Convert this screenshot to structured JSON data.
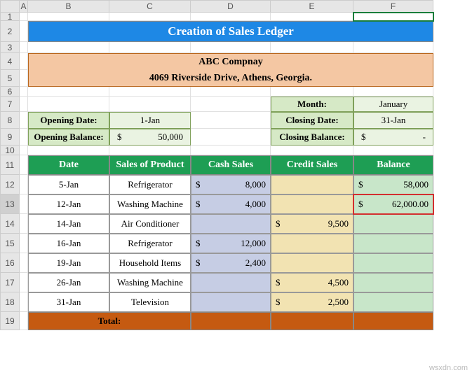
{
  "columns": [
    "A",
    "B",
    "C",
    "D",
    "E",
    "F"
  ],
  "rows": [
    "1",
    "2",
    "3",
    "4",
    "5",
    "6",
    "7",
    "8",
    "9",
    "10",
    "11",
    "12",
    "13",
    "14",
    "15",
    "16",
    "17",
    "18",
    "19"
  ],
  "title": "Creation of Sales Ledger",
  "company": {
    "name": "ABC Compnay",
    "address": "4069 Riverside Drive, Athens, Georgia."
  },
  "opening": {
    "date_label": "Opening Date:",
    "date_value": "1-Jan",
    "balance_label": "Opening Balance:",
    "balance_value": "50,000"
  },
  "closing": {
    "month_label": "Month:",
    "month_value": "January",
    "date_label": "Closing Date:",
    "date_value": "31-Jan",
    "balance_label": "Closing Balance:",
    "balance_value": "-"
  },
  "headers": {
    "date": "Date",
    "product": "Sales of Product",
    "cash": "Cash Sales",
    "credit": "Credit Sales",
    "balance": "Balance"
  },
  "rows_data": [
    {
      "date": "5-Jan",
      "product": "Refrigerator",
      "cash": "8,000",
      "credit": "",
      "balance": "58,000"
    },
    {
      "date": "12-Jan",
      "product": "Washing Machine",
      "cash": "4,000",
      "credit": "",
      "balance": "62,000.00"
    },
    {
      "date": "14-Jan",
      "product": "Air Conditioner",
      "cash": "",
      "credit": "9,500",
      "balance": ""
    },
    {
      "date": "16-Jan",
      "product": "Refrigerator",
      "cash": "12,000",
      "credit": "",
      "balance": ""
    },
    {
      "date": "19-Jan",
      "product": "Household Items",
      "cash": "2,400",
      "credit": "",
      "balance": ""
    },
    {
      "date": "26-Jan",
      "product": "Washing Machine",
      "cash": "",
      "credit": "4,500",
      "balance": ""
    },
    {
      "date": "31-Jan",
      "product": "Television",
      "cash": "",
      "credit": "2,500",
      "balance": ""
    }
  ],
  "total_label": "Total:",
  "currency": "$",
  "watermark": "wsxdn.com",
  "chart_data": {
    "type": "table",
    "title": "Creation of Sales Ledger",
    "columns": [
      "Date",
      "Sales of Product",
      "Cash Sales",
      "Credit Sales",
      "Balance"
    ],
    "rows": [
      [
        "5-Jan",
        "Refrigerator",
        8000,
        null,
        58000
      ],
      [
        "12-Jan",
        "Washing Machine",
        4000,
        null,
        62000.0
      ],
      [
        "14-Jan",
        "Air Conditioner",
        null,
        9500,
        null
      ],
      [
        "16-Jan",
        "Refrigerator",
        12000,
        null,
        null
      ],
      [
        "19-Jan",
        "Household Items",
        2400,
        null,
        null
      ],
      [
        "26-Jan",
        "Washing Machine",
        null,
        4500,
        null
      ],
      [
        "31-Jan",
        "Television",
        null,
        2500,
        null
      ]
    ],
    "opening_balance": 50000,
    "opening_date": "1-Jan",
    "closing_date": "31-Jan",
    "month": "January"
  }
}
